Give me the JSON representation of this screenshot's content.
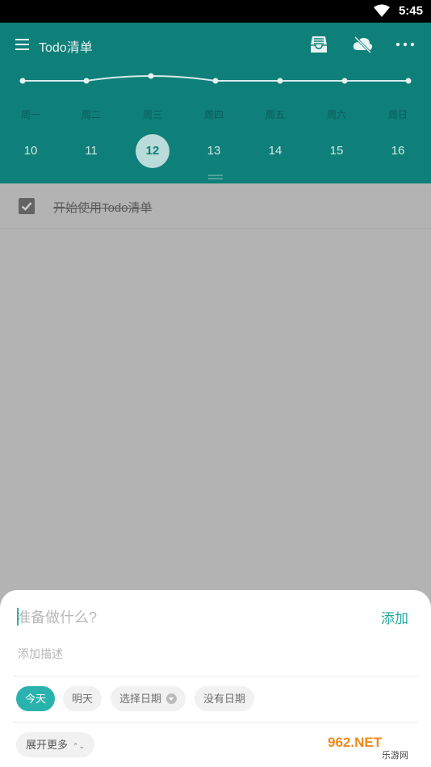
{
  "status": {
    "time": "5:45"
  },
  "header": {
    "title": "Todo清单"
  },
  "week": {
    "days": [
      "周一",
      "周二",
      "周三",
      "周四",
      "周五",
      "周六",
      "周日"
    ],
    "dates": [
      "10",
      "11",
      "12",
      "13",
      "14",
      "15",
      "16"
    ],
    "selected_index": 2
  },
  "todos": [
    {
      "text": "开始使用Todo清单",
      "done": true
    }
  ],
  "sheet": {
    "title_placeholder": "准备做什么?",
    "add_label": "添加",
    "desc_placeholder": "添加描述",
    "chips": [
      "今天",
      "明天",
      "选择日期",
      "没有日期"
    ],
    "expand_label": "展开更多"
  },
  "watermark": {
    "main": "962.NET",
    "sub": "乐游网"
  },
  "colors": {
    "accent": "#0f7f79",
    "chip_active": "#2ab3ae",
    "overlay": "#b3b3b3"
  }
}
